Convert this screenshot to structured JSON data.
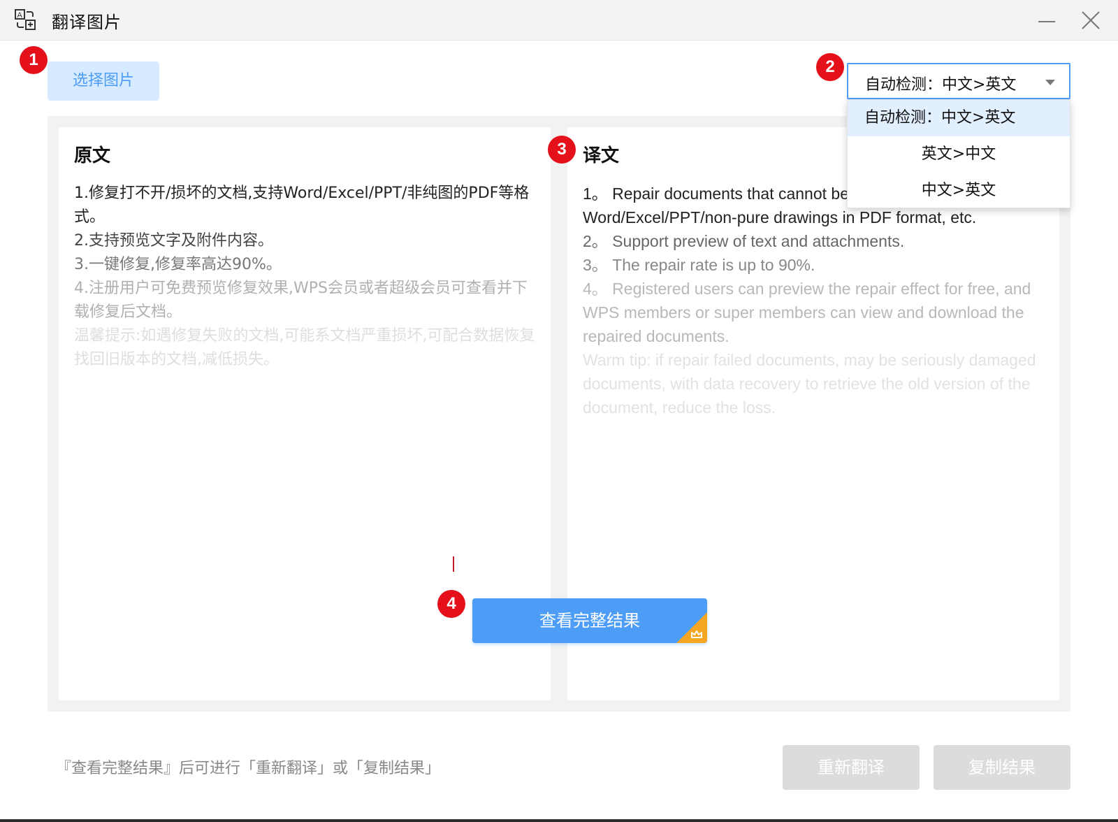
{
  "window": {
    "title": "翻译图片",
    "icon": "translate-image-icon"
  },
  "toolbar": {
    "select_image_label": "选择图片"
  },
  "language": {
    "selected": "自动检测：中文>英文",
    "options": [
      "自动检测：中文>英文",
      "英文>中文",
      "中文>英文"
    ]
  },
  "badges": [
    "1",
    "2",
    "3",
    "4"
  ],
  "source": {
    "heading": "原文",
    "lines": [
      "1.修复打不开/损坏的文档,支持Word/Excel/PPT/非纯图的PDF等格式。",
      "2.支持预览文字及附件内容。",
      "3.一键修复,修复率高达90%。",
      "4.注册用户可免费预览修复效果,WPS会员或者超级会员可查看并下载修复后文档。",
      "温馨提示:如遇修复失败的文档,可能系文档严重损坏,可配合数据恢复找回旧版本的文档,减低损失。"
    ]
  },
  "translation": {
    "heading": "译文",
    "lines": [
      "1。 Repair documents that cannot be opened/damaged, support Word/Excel/PPT/non-pure drawings in PDF format, etc.",
      "2。 Support preview of text and attachments.",
      "3。 The repair rate is up to 90%.",
      "4。 Registered users can preview the repair effect for free, and WPS members or super members can view and download the repaired documents.",
      "Warm tip: if repair failed documents, may be seriously damaged documents, with data recovery to retrieve the old version of the document, reduce the loss."
    ]
  },
  "view_full_label": "查看完整结果",
  "footer": {
    "note": "『查看完整结果』后可进行「重新翻译」或「复制结果」",
    "retranslate_label": "重新翻译",
    "copy_label": "复制结果"
  },
  "colors": {
    "accent": "#4d9cf5",
    "badge": "#e4111b",
    "select_bg": "#d6ebff",
    "disabled_btn": "#dcdcdc",
    "vip": "#f5a623"
  }
}
